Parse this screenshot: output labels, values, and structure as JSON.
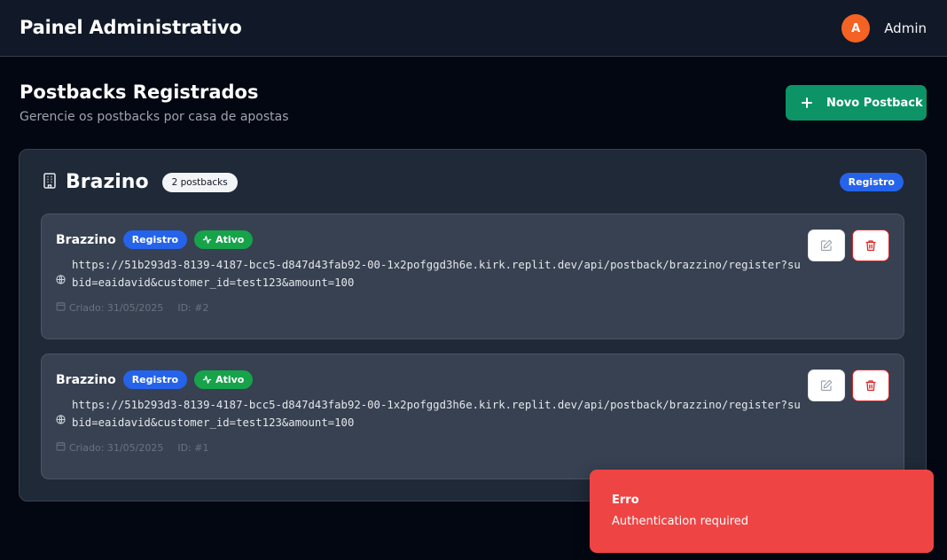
{
  "header": {
    "title": "Painel Administrativo",
    "user_initial": "A",
    "user_name": "Admin"
  },
  "page": {
    "title": "Postbacks Registrados",
    "subtitle": "Gerencie os postbacks por casa de apostas",
    "new_button_label": "Novo Postback"
  },
  "house": {
    "name": "Brazino",
    "count_label": "2 postbacks",
    "category_label": "Registro",
    "icon": "building-icon",
    "postbacks": [
      {
        "name": "Brazzino",
        "type_label": "Registro",
        "status_label": "Ativo",
        "url": "https://51b293d3-8139-4187-bcc5-d847d43fab92-00-1x2pofggd3h6e.kirk.replit.dev/api/postback/brazzino/register?subid=eaidavid&customer_id=test123&amount=100",
        "created": "Criado: 31/05/2025",
        "id_label": "ID: #2"
      },
      {
        "name": "Brazzino",
        "type_label": "Registro",
        "status_label": "Ativo",
        "url": "https://51b293d3-8139-4187-bcc5-d847d43fab92-00-1x2pofggd3h6e.kirk.replit.dev/api/postback/brazzino/register?subid=eaidavid&customer_id=test123&amount=100",
        "created": "Criado: 31/05/2025",
        "id_label": "ID: #1"
      }
    ]
  },
  "toast": {
    "title": "Erro",
    "message": "Authentication required"
  },
  "colors": {
    "background": "#030712",
    "primary_button": "#0c9466",
    "badge_blue": "#2563eb",
    "badge_green": "#16a34a",
    "error": "#ef4444",
    "avatar": "#f46224"
  }
}
